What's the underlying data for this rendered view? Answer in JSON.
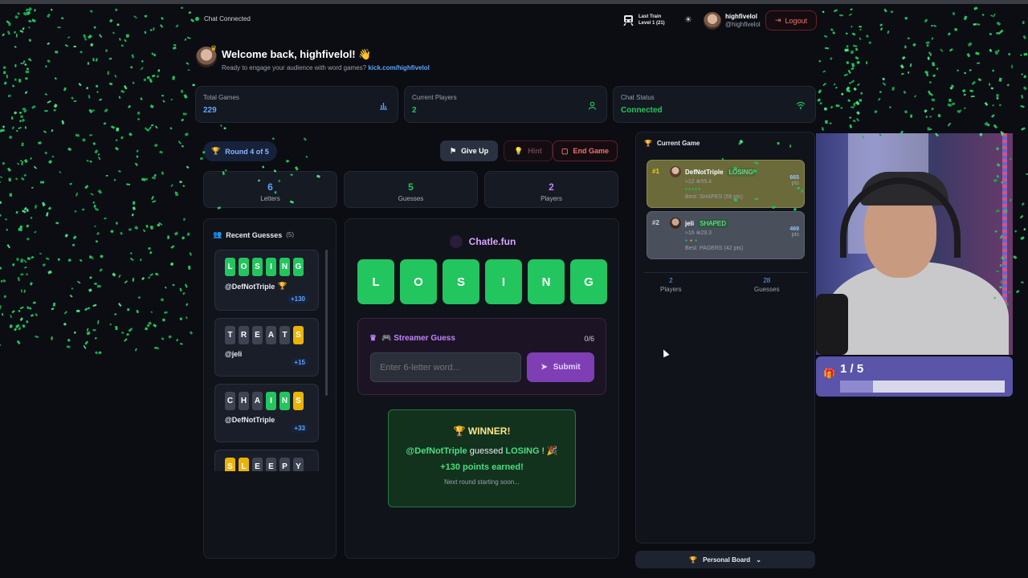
{
  "topbar": {
    "chat_status": "Chat Connected",
    "last_train_label": "Last Train",
    "last_train_level": "Level 1 (21)",
    "username": "highfivelol",
    "handle": "@highfivelol",
    "logout": "Logout"
  },
  "welcome": {
    "title": "Welcome back, highfivelol! 👋",
    "subtitle": "Ready to engage your audience with word games?",
    "link": "kick.com/highfivelol"
  },
  "stats": [
    {
      "label": "Total Games",
      "value": "229",
      "color": "#60a5fa",
      "icon": "chart-icon"
    },
    {
      "label": "Current Players",
      "value": "2",
      "color": "#22c55e",
      "icon": "user-icon"
    },
    {
      "label": "Chat Status",
      "value": "Connected",
      "color": "#22c55e",
      "icon": "wifi-icon"
    }
  ],
  "round": {
    "label": "Round 4 of 5"
  },
  "actions": {
    "give_up": "Give Up",
    "hint": "Hint",
    "end_game": "End Game"
  },
  "info": [
    {
      "value": "6",
      "label": "Letters",
      "color": "#60a5fa"
    },
    {
      "value": "5",
      "label": "Guesses",
      "color": "#22c55e"
    },
    {
      "value": "2",
      "label": "Players",
      "color": "#c084fc"
    }
  ],
  "recent": {
    "title": "Recent Guesses",
    "count": "(5)",
    "items": [
      {
        "letters": [
          "L",
          "O",
          "S",
          "I",
          "N",
          "G"
        ],
        "states": [
          "g",
          "g",
          "g",
          "g",
          "g",
          "g"
        ],
        "user": "@DefNotTriple",
        "points": "+130",
        "trophy": true
      },
      {
        "letters": [
          "T",
          "R",
          "E",
          "A",
          "T",
          "S"
        ],
        "states": [
          "x",
          "x",
          "x",
          "x",
          "x",
          "y"
        ],
        "user": "@jeli",
        "points": "+15",
        "trophy": false
      },
      {
        "letters": [
          "C",
          "H",
          "A",
          "I",
          "N",
          "S"
        ],
        "states": [
          "x",
          "x",
          "x",
          "g",
          "g",
          "y"
        ],
        "user": "@DefNotTriple",
        "points": "+33",
        "trophy": false
      },
      {
        "letters": [
          "S",
          "L",
          "E",
          "E",
          "P",
          "Y"
        ],
        "states": [
          "y",
          "y",
          "x",
          "x",
          "x",
          "x"
        ],
        "user": "",
        "points": "",
        "trophy": false
      }
    ]
  },
  "board": {
    "brand": "Chatle.fun",
    "letters": [
      "L",
      "O",
      "S",
      "I",
      "N",
      "G"
    ]
  },
  "streamer": {
    "title": "🎮 Streamer Guess",
    "count": "0/6",
    "placeholder": "Enter 6-letter word...",
    "submit": "Submit"
  },
  "winner": {
    "title": "WINNER!",
    "user": "@DefNotTriple",
    "verb": "guessed",
    "word": "LOSING",
    "suffix": "! 🎉",
    "points": "+130 points earned!",
    "next": "Next round starting soon..."
  },
  "current_game": {
    "title": "Current Game",
    "entries": [
      {
        "rank": "#1",
        "name": "DefNotTriple",
        "tag": "LOSING",
        "meta": "≈12 ⊗55.4",
        "best": "Best: SHAPES (56 pts)",
        "pts": "665",
        "pts_label": "pts"
      },
      {
        "rank": "#2",
        "name": "jeli",
        "tag": "SHAPED",
        "meta": "≈16 ⊗29.3",
        "best": "Best: PAGERS (42 pts)",
        "pts": "469",
        "pts_label": "pts"
      }
    ],
    "players_value": "2",
    "players_label": "Players",
    "guesses_value": "28",
    "guesses_label": "Guesses"
  },
  "personal_board": "Personal Board",
  "overlay": {
    "progress_text": "1 / 5",
    "progress": 0.2
  }
}
